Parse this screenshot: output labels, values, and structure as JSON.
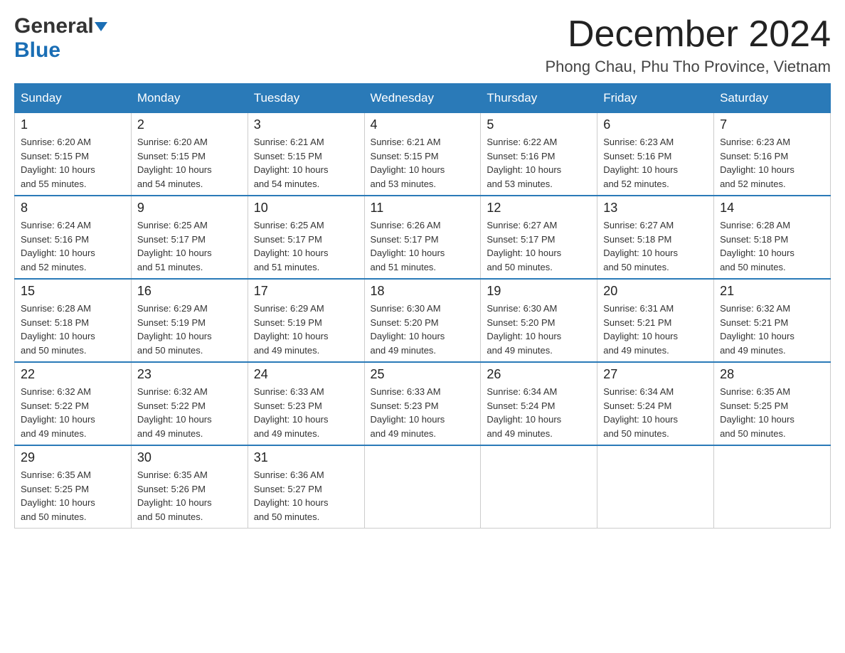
{
  "logo": {
    "general": "General",
    "blue": "Blue",
    "triangle": "▼"
  },
  "title": "December 2024",
  "subtitle": "Phong Chau, Phu Tho Province, Vietnam",
  "days_of_week": [
    "Sunday",
    "Monday",
    "Tuesday",
    "Wednesday",
    "Thursday",
    "Friday",
    "Saturday"
  ],
  "weeks": [
    [
      {
        "day": "1",
        "sunrise": "6:20 AM",
        "sunset": "5:15 PM",
        "daylight": "10 hours and 55 minutes."
      },
      {
        "day": "2",
        "sunrise": "6:20 AM",
        "sunset": "5:15 PM",
        "daylight": "10 hours and 54 minutes."
      },
      {
        "day": "3",
        "sunrise": "6:21 AM",
        "sunset": "5:15 PM",
        "daylight": "10 hours and 54 minutes."
      },
      {
        "day": "4",
        "sunrise": "6:21 AM",
        "sunset": "5:15 PM",
        "daylight": "10 hours and 53 minutes."
      },
      {
        "day": "5",
        "sunrise": "6:22 AM",
        "sunset": "5:16 PM",
        "daylight": "10 hours and 53 minutes."
      },
      {
        "day": "6",
        "sunrise": "6:23 AM",
        "sunset": "5:16 PM",
        "daylight": "10 hours and 52 minutes."
      },
      {
        "day": "7",
        "sunrise": "6:23 AM",
        "sunset": "5:16 PM",
        "daylight": "10 hours and 52 minutes."
      }
    ],
    [
      {
        "day": "8",
        "sunrise": "6:24 AM",
        "sunset": "5:16 PM",
        "daylight": "10 hours and 52 minutes."
      },
      {
        "day": "9",
        "sunrise": "6:25 AM",
        "sunset": "5:17 PM",
        "daylight": "10 hours and 51 minutes."
      },
      {
        "day": "10",
        "sunrise": "6:25 AM",
        "sunset": "5:17 PM",
        "daylight": "10 hours and 51 minutes."
      },
      {
        "day": "11",
        "sunrise": "6:26 AM",
        "sunset": "5:17 PM",
        "daylight": "10 hours and 51 minutes."
      },
      {
        "day": "12",
        "sunrise": "6:27 AM",
        "sunset": "5:17 PM",
        "daylight": "10 hours and 50 minutes."
      },
      {
        "day": "13",
        "sunrise": "6:27 AM",
        "sunset": "5:18 PM",
        "daylight": "10 hours and 50 minutes."
      },
      {
        "day": "14",
        "sunrise": "6:28 AM",
        "sunset": "5:18 PM",
        "daylight": "10 hours and 50 minutes."
      }
    ],
    [
      {
        "day": "15",
        "sunrise": "6:28 AM",
        "sunset": "5:18 PM",
        "daylight": "10 hours and 50 minutes."
      },
      {
        "day": "16",
        "sunrise": "6:29 AM",
        "sunset": "5:19 PM",
        "daylight": "10 hours and 50 minutes."
      },
      {
        "day": "17",
        "sunrise": "6:29 AM",
        "sunset": "5:19 PM",
        "daylight": "10 hours and 49 minutes."
      },
      {
        "day": "18",
        "sunrise": "6:30 AM",
        "sunset": "5:20 PM",
        "daylight": "10 hours and 49 minutes."
      },
      {
        "day": "19",
        "sunrise": "6:30 AM",
        "sunset": "5:20 PM",
        "daylight": "10 hours and 49 minutes."
      },
      {
        "day": "20",
        "sunrise": "6:31 AM",
        "sunset": "5:21 PM",
        "daylight": "10 hours and 49 minutes."
      },
      {
        "day": "21",
        "sunrise": "6:32 AM",
        "sunset": "5:21 PM",
        "daylight": "10 hours and 49 minutes."
      }
    ],
    [
      {
        "day": "22",
        "sunrise": "6:32 AM",
        "sunset": "5:22 PM",
        "daylight": "10 hours and 49 minutes."
      },
      {
        "day": "23",
        "sunrise": "6:32 AM",
        "sunset": "5:22 PM",
        "daylight": "10 hours and 49 minutes."
      },
      {
        "day": "24",
        "sunrise": "6:33 AM",
        "sunset": "5:23 PM",
        "daylight": "10 hours and 49 minutes."
      },
      {
        "day": "25",
        "sunrise": "6:33 AM",
        "sunset": "5:23 PM",
        "daylight": "10 hours and 49 minutes."
      },
      {
        "day": "26",
        "sunrise": "6:34 AM",
        "sunset": "5:24 PM",
        "daylight": "10 hours and 49 minutes."
      },
      {
        "day": "27",
        "sunrise": "6:34 AM",
        "sunset": "5:24 PM",
        "daylight": "10 hours and 50 minutes."
      },
      {
        "day": "28",
        "sunrise": "6:35 AM",
        "sunset": "5:25 PM",
        "daylight": "10 hours and 50 minutes."
      }
    ],
    [
      {
        "day": "29",
        "sunrise": "6:35 AM",
        "sunset": "5:25 PM",
        "daylight": "10 hours and 50 minutes."
      },
      {
        "day": "30",
        "sunrise": "6:35 AM",
        "sunset": "5:26 PM",
        "daylight": "10 hours and 50 minutes."
      },
      {
        "day": "31",
        "sunrise": "6:36 AM",
        "sunset": "5:27 PM",
        "daylight": "10 hours and 50 minutes."
      },
      null,
      null,
      null,
      null
    ]
  ],
  "labels": {
    "sunrise": "Sunrise:",
    "sunset": "Sunset:",
    "daylight": "Daylight:"
  },
  "colors": {
    "header_bg": "#2a7ab8",
    "accent_blue": "#1a6eb5"
  }
}
